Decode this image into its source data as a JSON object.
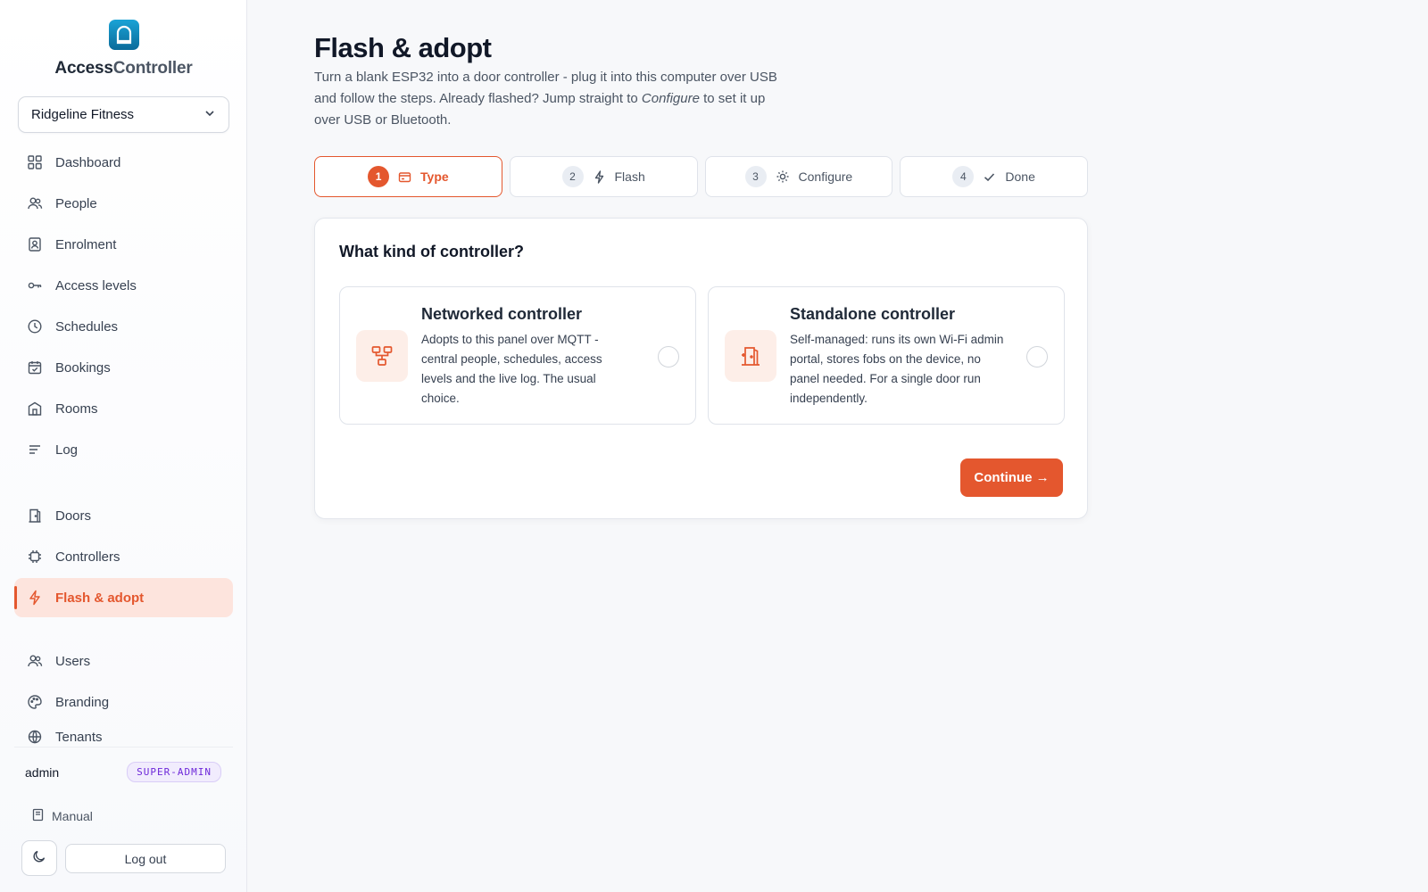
{
  "brand": {
    "name_bold": "Access",
    "name_light": "Controller"
  },
  "tenant": {
    "selected": "Ridgeline Fitness"
  },
  "nav": {
    "group1": [
      {
        "label": "Dashboard",
        "icon": "grid-icon"
      },
      {
        "label": "People",
        "icon": "people-icon"
      },
      {
        "label": "Enrolment",
        "icon": "badge-icon"
      },
      {
        "label": "Access levels",
        "icon": "key-icon"
      },
      {
        "label": "Schedules",
        "icon": "clock-icon"
      },
      {
        "label": "Bookings",
        "icon": "calendar-check-icon"
      },
      {
        "label": "Rooms",
        "icon": "room-icon"
      },
      {
        "label": "Log",
        "icon": "lines-icon"
      }
    ],
    "group2": [
      {
        "label": "Doors",
        "icon": "door-icon"
      },
      {
        "label": "Controllers",
        "icon": "chip-icon"
      },
      {
        "label": "Flash & adopt",
        "icon": "bolt-icon",
        "active": true
      }
    ],
    "group3": [
      {
        "label": "Users",
        "icon": "users-icon"
      },
      {
        "label": "Branding",
        "icon": "palette-icon"
      },
      {
        "label": "Tenants",
        "icon": "building-icon"
      }
    ]
  },
  "user": {
    "name": "admin",
    "role": "SUPER-ADMIN"
  },
  "manual": {
    "label": "Manual"
  },
  "logout": {
    "label": "Log out"
  },
  "page": {
    "title": "Flash & adopt",
    "desc_part1": "Turn a blank ESP32 into a door controller - plug it into this computer over USB and follow the steps. Already flashed? Jump straight to ",
    "desc_em": "Configure",
    "desc_part2": " to set it up over USB or Bluetooth."
  },
  "steps": [
    {
      "num": "1",
      "label": "Type",
      "icon": "card-icon",
      "active": true
    },
    {
      "num": "2",
      "label": "Flash",
      "icon": "bolt-icon"
    },
    {
      "num": "3",
      "label": "Configure",
      "icon": "sun-gear-icon"
    },
    {
      "num": "4",
      "label": "Done",
      "icon": "check-icon"
    }
  ],
  "card": {
    "title": "What kind of controller?",
    "options": [
      {
        "title": "Networked controller",
        "desc": "Adopts to this panel over MQTT - central people, schedules, access levels and the live log. The usual choice.",
        "icon": "network-icon"
      },
      {
        "title": "Standalone controller",
        "desc": "Self-managed: runs its own Wi-Fi admin portal, stores fobs on the device, no panel needed. For a single door run independently.",
        "icon": "standalone-door-icon"
      }
    ],
    "continue_label": "Continue →"
  },
  "colors": {
    "accent": "#e4572e",
    "accent_bg": "#fde4dd",
    "role_purple": "#6d28d9"
  }
}
